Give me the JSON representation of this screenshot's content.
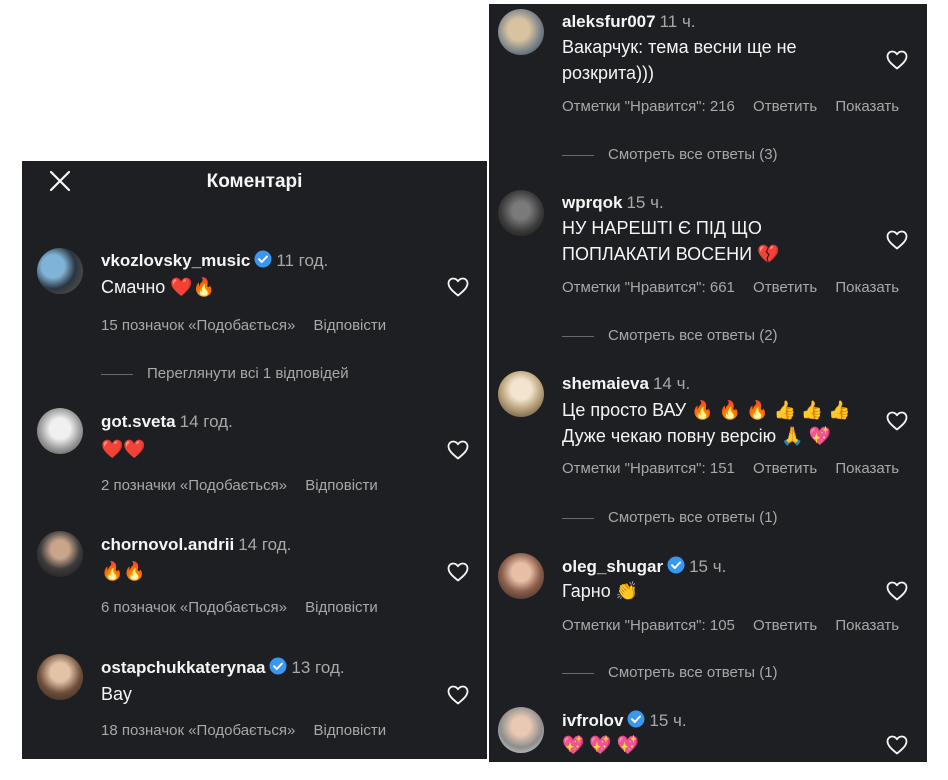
{
  "left_panel": {
    "title": "Коментарі",
    "comments": [
      {
        "username": "vkozlovsky_music",
        "verified": true,
        "time": "11 год.",
        "text": "Смачно ❤️🔥",
        "likes": "15 позначок «Подобається»",
        "reply": "Відповісти",
        "view_replies": "Переглянути всі 1 відповідей"
      },
      {
        "username": "got.sveta",
        "verified": false,
        "time": "14 год.",
        "text": "❤️❤️",
        "likes": "2 позначки «Подобається»",
        "reply": "Відповісти"
      },
      {
        "username": "chornovol.andrii",
        "verified": false,
        "time": "14 год.",
        "text": "🔥🔥",
        "likes": "6 позначок «Подобається»",
        "reply": "Відповісти"
      },
      {
        "username": "ostapchukkaterynaa",
        "verified": true,
        "time": "13 год.",
        "text": "Вау",
        "likes": "18 позначок «Подобається»",
        "reply": "Відповісти"
      }
    ]
  },
  "right_panel": {
    "comments": [
      {
        "username": "aleksfur007",
        "verified": false,
        "time": "11 ч.",
        "text_line1": "Вакарчук: тема весни ще не",
        "text_line2": "розкрита)))",
        "likes": "Отметки \"Нравится\": 216",
        "reply": "Ответить",
        "show": "Показать",
        "view_replies": "Смотреть все ответы (3)"
      },
      {
        "username": "wprqok",
        "verified": false,
        "time": "15 ч.",
        "text_line1": "НУ НАРЕШТІ Є ПІД ЩО",
        "text_line2": "ПОПЛАКАТИ ВОСЕНИ 💔",
        "likes": "Отметки \"Нравится\": 661",
        "reply": "Ответить",
        "show": "Показать",
        "view_replies": "Смотреть все ответы (2)"
      },
      {
        "username": "shemaieva",
        "verified": false,
        "time": "14 ч.",
        "text_line1": "Це просто ВАУ 🔥 🔥 🔥 👍 👍 👍",
        "text_line2": "Дуже чекаю повну версію 🙏 💖",
        "likes": "Отметки \"Нравится\": 151",
        "reply": "Ответить",
        "show": "Показать",
        "view_replies": "Смотреть все ответы (1)"
      },
      {
        "username": "oleg_shugar",
        "verified": true,
        "time": "15 ч.",
        "text_line1": "Гарно 👏",
        "likes": "Отметки \"Нравится\": 105",
        "reply": "Ответить",
        "show": "Показать",
        "view_replies": "Смотреть все ответы (1)"
      },
      {
        "username": "ivfrolov",
        "verified": true,
        "time": "15 ч.",
        "text_line1": "💖 💖 💖"
      }
    ]
  },
  "colors": {
    "panel_bg": "#1e1f22",
    "text": "#f5f5f5",
    "secondary": "#a8a8a8",
    "verified": "#3897f0",
    "heart_icon": "#f5f5f5"
  },
  "icons": [
    "close-icon",
    "heart-outline-icon",
    "verified-badge-icon"
  ]
}
